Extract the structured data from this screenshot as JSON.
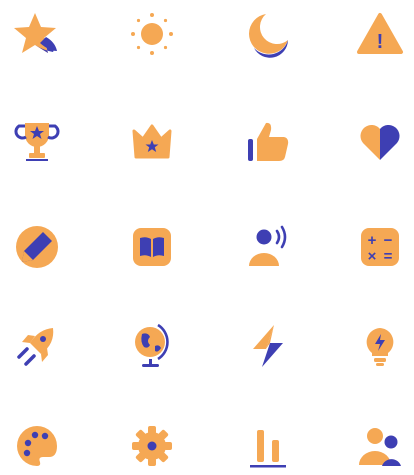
{
  "colors": {
    "primary": "#F5A854",
    "secondary": "#3E3FB3"
  },
  "icons": [
    [
      "star-icon",
      "sun-icon",
      "moon-icon",
      "warning-icon"
    ],
    [
      "trophy-icon",
      "crown-icon",
      "thumbs-up-icon",
      "heart-icon"
    ],
    [
      "pencil-icon",
      "book-icon",
      "speaking-user-icon",
      "calculator-icon"
    ],
    [
      "rocket-icon",
      "globe-icon",
      "lightning-icon",
      "lightbulb-icon"
    ],
    [
      "palette-icon",
      "gear-icon",
      "bar-chart-icon",
      "users-icon"
    ]
  ],
  "warning": {
    "mark": "!"
  },
  "calculator": {
    "keys": [
      "+",
      "−",
      "×",
      "="
    ]
  }
}
